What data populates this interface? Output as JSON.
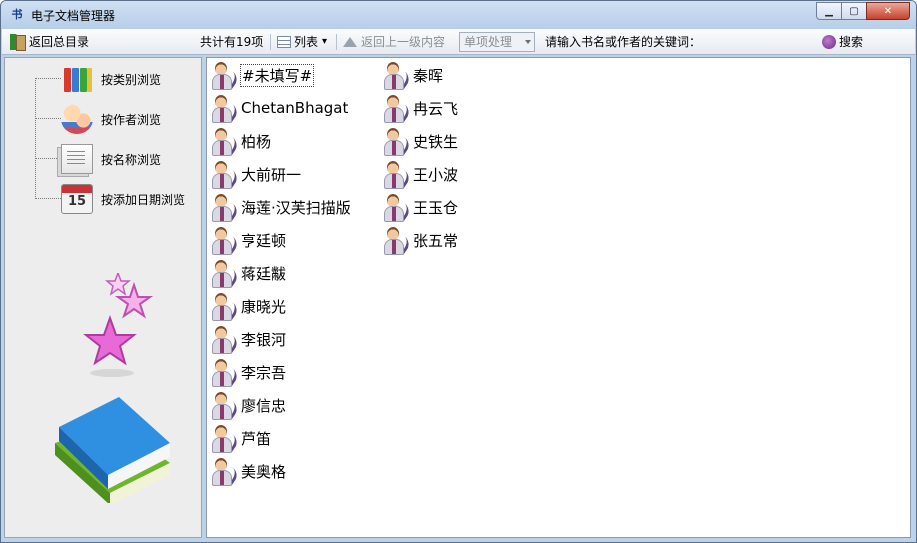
{
  "window": {
    "icon_glyph": "书",
    "title": "电子文档管理器",
    "controls": {
      "minimize": "▁",
      "maximize": "▢",
      "close": "✕"
    }
  },
  "toolbar": {
    "back_home_label": "返回总目录",
    "total_count": "共计有19项",
    "view_label": "列表",
    "view_caret": "▾",
    "up_level_label": "返回上一级内容",
    "process_combo_value": "单项处理",
    "search_prompt": "请输入书名或作者的关键词：",
    "search_value": "",
    "search_button_label": "搜索"
  },
  "sidebar": {
    "items": [
      {
        "label": "按类别浏览",
        "icon": "binders-icon"
      },
      {
        "label": "按作者浏览",
        "icon": "people-icon"
      },
      {
        "label": "按名称浏览",
        "icon": "documents-icon"
      },
      {
        "label": "按添加日期浏览",
        "icon": "calendar-icon",
        "icon_text": "15"
      }
    ]
  },
  "authors": {
    "column1": [
      "#未填写#",
      "ChetanBhagat",
      "柏杨",
      "大前研一",
      "海莲·汉芙扫描版",
      "亨廷顿",
      "蒋廷黻",
      "康晓光",
      "李银河",
      "李宗吾",
      "廖信忠",
      "芦笛",
      "美奥格"
    ],
    "column2": [
      "秦晖",
      "冉云飞",
      "史铁生",
      "王小波",
      "王玉仓",
      "张五常"
    ],
    "selected_index": 0
  },
  "colors": {
    "title_bar": "#bcd2ea",
    "close_button": "#c8412b",
    "content_bg": "#ffffff",
    "sidebar_bg": "#ededed"
  }
}
